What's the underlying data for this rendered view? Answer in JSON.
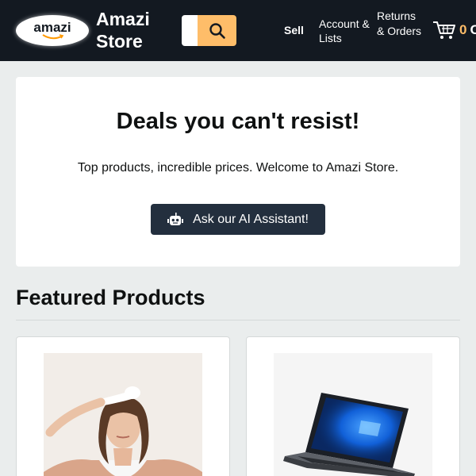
{
  "header": {
    "logo_text": "amazi",
    "store_name": "Amazi Store",
    "nav": {
      "sell": "Sell",
      "account": "Account & Lists",
      "returns": "Returns & Orders"
    },
    "cart": {
      "count": "0",
      "label": "C"
    }
  },
  "hero": {
    "title": "Deals you can't resist!",
    "subtitle": "Top products, incredible prices. Welcome to Amazi Store.",
    "button_label": "Ask our AI Assistant!"
  },
  "featured": {
    "title": "Featured Products"
  },
  "colors": {
    "nav_bg": "#131921",
    "accent": "#febd69",
    "button_dark": "#232f3e",
    "page_bg": "#eaeded"
  },
  "icons": [
    "search-icon",
    "cart-icon",
    "robot-icon"
  ]
}
